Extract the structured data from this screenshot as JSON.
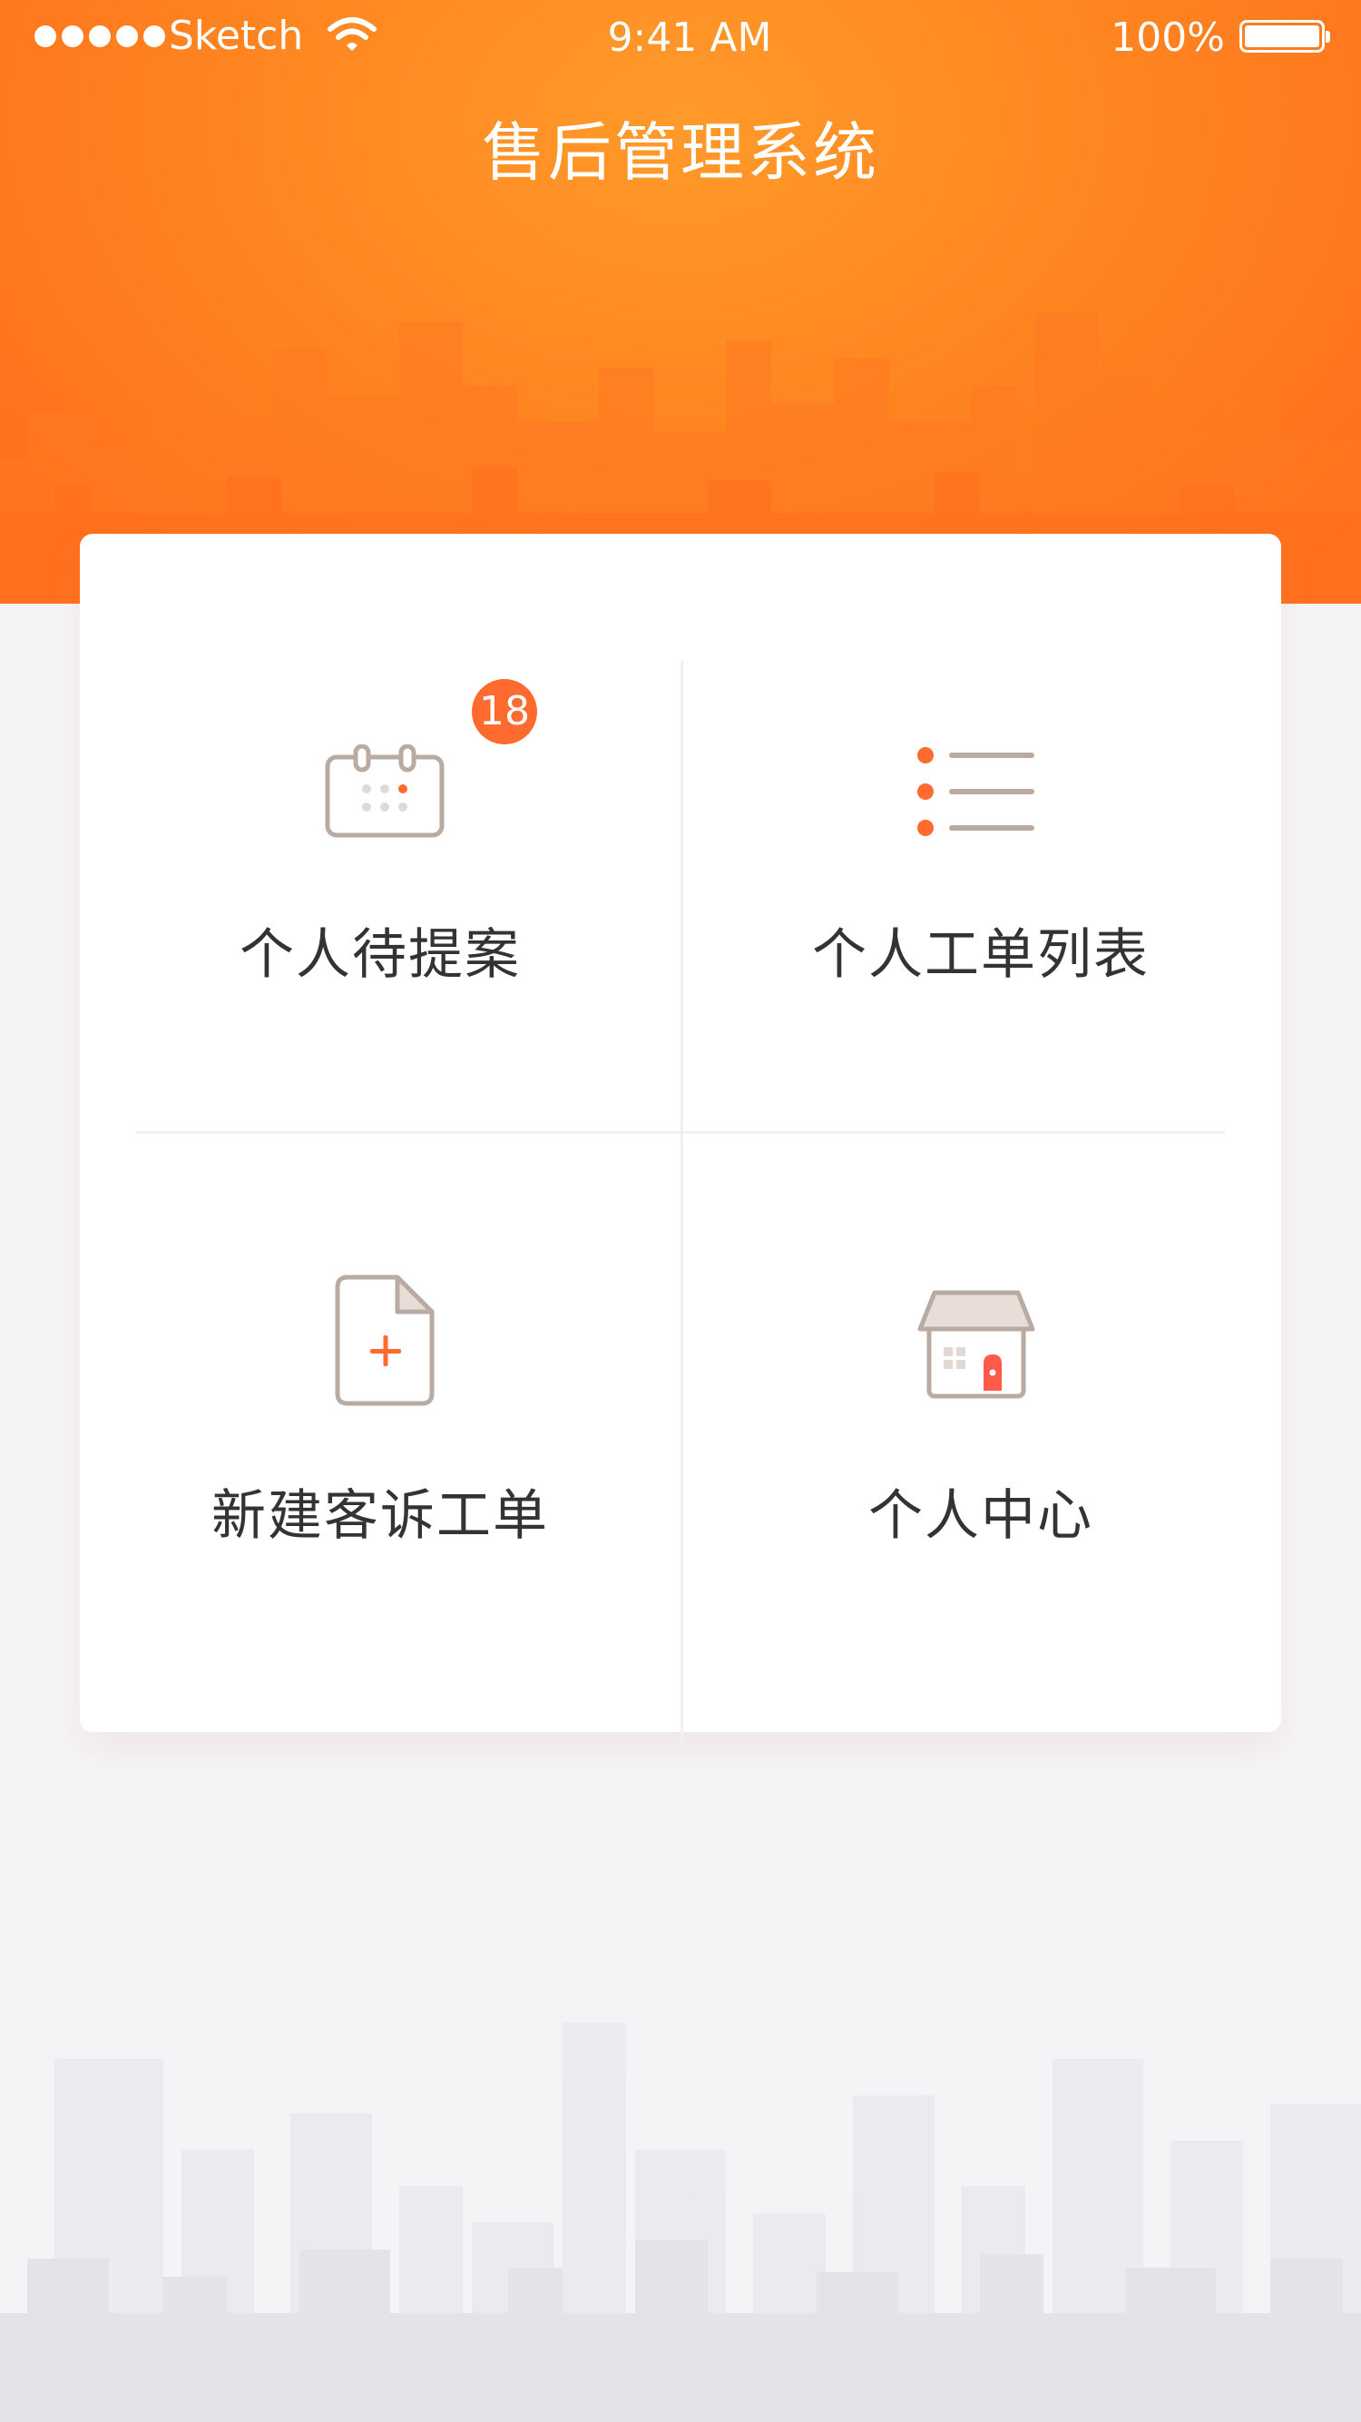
{
  "status_bar": {
    "carrier": "Sketch",
    "time": "9:41 AM",
    "battery": "100%"
  },
  "header": {
    "title": "售后管理系统"
  },
  "menu": {
    "items": [
      {
        "label": "个人待提案",
        "icon": "calendar-icon",
        "badge": "18"
      },
      {
        "label": "个人工单列表",
        "icon": "list-icon"
      },
      {
        "label": "新建客诉工单",
        "icon": "new-document-icon"
      },
      {
        "label": "个人中心",
        "icon": "house-icon"
      }
    ]
  },
  "colors": {
    "accent": "#ff6a2e",
    "header_orange": "#ff8520",
    "icon_outline": "#b9aaa2",
    "background": "#f4f4f7"
  }
}
